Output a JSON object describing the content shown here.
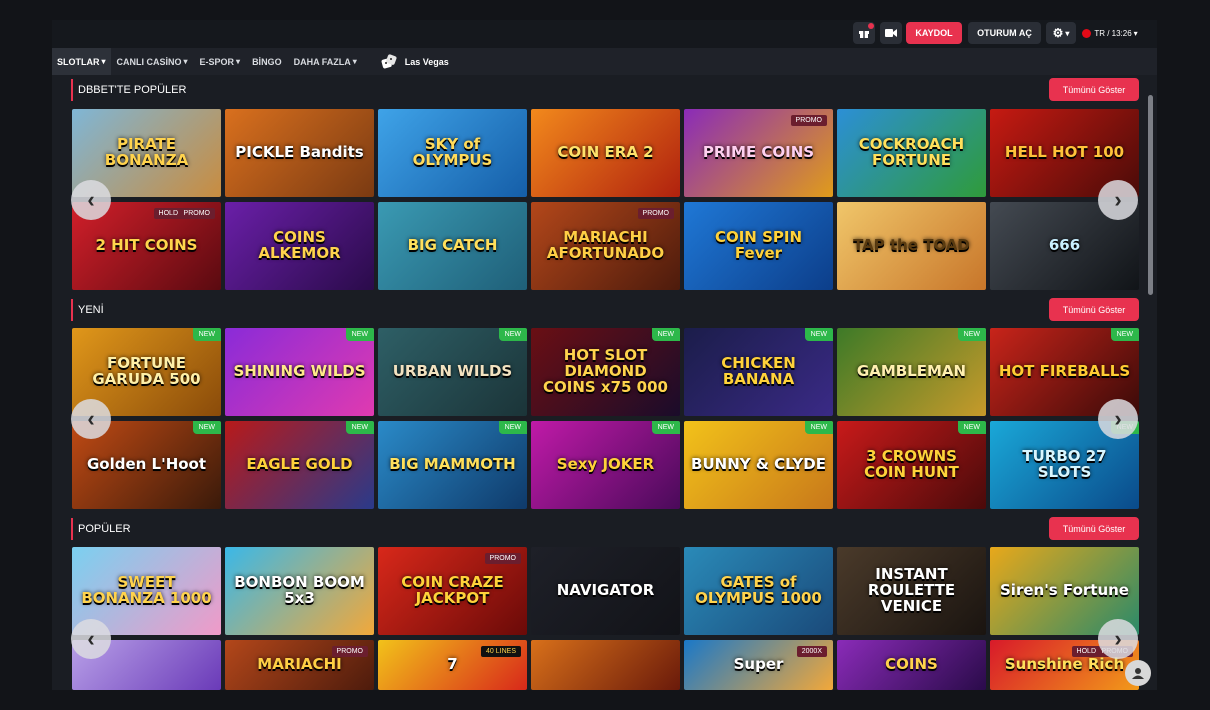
{
  "topbar": {
    "register_label": "KAYDOL",
    "login_label": "OTURUM AÇ",
    "lang_time": "TR / 13:26"
  },
  "nav": {
    "items": [
      {
        "label": "SLOTLAR",
        "dropdown": true
      },
      {
        "label": "CANLI CASİNO",
        "dropdown": true
      },
      {
        "label": "E-SPOR",
        "dropdown": true
      },
      {
        "label": "BİNGO",
        "dropdown": false
      },
      {
        "label": "DAHA FAZLA",
        "dropdown": true
      }
    ],
    "las_vegas": "Las Vegas"
  },
  "sections": [
    {
      "title": "DBBET'TE POPÜLER",
      "show_all": "Tümünü Göster",
      "games": [
        {
          "name": "PIRATE BONANZA",
          "bg": [
            "#7fb6d6",
            "#c98c3f"
          ],
          "color": "#ffd34d"
        },
        {
          "name": "PICKLE Bandits",
          "bg": [
            "#d9701e",
            "#7a3a12"
          ],
          "color": "#ffffff"
        },
        {
          "name": "SKY of OLYMPUS",
          "bg": [
            "#3fa3e8",
            "#155ea8"
          ],
          "color": "#ffdc5c"
        },
        {
          "name": "COIN ERA 2",
          "bg": [
            "#f2891c",
            "#b0210e"
          ],
          "color": "#ffe26b"
        },
        {
          "name": "PRIME COINS",
          "bg": [
            "#8a2bb8",
            "#e09c1a"
          ],
          "color": "#ffd0f0",
          "badge": "PROMO"
        },
        {
          "name": "COCKROACH FORTUNE",
          "bg": [
            "#2c8fd6",
            "#2f9b3a"
          ],
          "color": "#ffe05c"
        },
        {
          "name": "HELL HOT 100",
          "bg": [
            "#c61a12",
            "#4a0b08"
          ],
          "color": "#ffc23a"
        },
        {
          "name": "2 HIT COINS",
          "bg": [
            "#d21f2a",
            "#5a0a10"
          ],
          "color": "#ffd54d",
          "badge": "PROMO",
          "badge2": "HOLD"
        },
        {
          "name": "COINS ALKEMOR",
          "bg": [
            "#6a1fa8",
            "#2a0b4a"
          ],
          "color": "#ffd34d"
        },
        {
          "name": "BIG CATCH",
          "bg": [
            "#3a9ab3",
            "#1f5f78"
          ],
          "color": "#ffe05c"
        },
        {
          "name": "MARIACHI AFORTUNADO",
          "bg": [
            "#b3471a",
            "#4d1b0c"
          ],
          "color": "#ffcf45",
          "badge": "PROMO"
        },
        {
          "name": "COIN SPIN Fever",
          "bg": [
            "#1f78d6",
            "#0c3e8a"
          ],
          "color": "#ffd23a"
        },
        {
          "name": "TAP the TOAD",
          "bg": [
            "#f0c66a",
            "#c8762a"
          ],
          "color": "#5a3b10"
        },
        {
          "name": "666",
          "bg": [
            "#444a52",
            "#111418"
          ],
          "color": "#c9f0ff"
        }
      ]
    },
    {
      "title": "YENİ",
      "show_all": "Tümünü Göster",
      "games": [
        {
          "name": "FORTUNE GARUDA 500",
          "bg": [
            "#e0971a",
            "#8a4b0a"
          ],
          "color": "#fff0a8",
          "badge": "NEW"
        },
        {
          "name": "SHINING WILDS",
          "bg": [
            "#8a2bd8",
            "#e03ab0"
          ],
          "color": "#ffe98a",
          "badge": "NEW"
        },
        {
          "name": "URBAN WILDS",
          "bg": [
            "#2e5f66",
            "#1b3438"
          ],
          "color": "#f2e2c0",
          "badge": "NEW"
        },
        {
          "name": "HOT SLOT DIAMOND COINS x75 000",
          "bg": [
            "#6a0f14",
            "#1a0c2a"
          ],
          "color": "#ffd34d",
          "badge": "NEW"
        },
        {
          "name": "CHICKEN BANANA",
          "bg": [
            "#1b1d4a",
            "#3a2a86"
          ],
          "color": "#ffd23a",
          "badge": "NEW"
        },
        {
          "name": "GAMBLEMAN",
          "bg": [
            "#3d7a28",
            "#c79a2a"
          ],
          "color": "#fff0b0",
          "badge": "NEW"
        },
        {
          "name": "HOT FIREBALLS",
          "bg": [
            "#c8241a",
            "#3a0a08"
          ],
          "color": "#ffcc33",
          "badge": "NEW"
        },
        {
          "name": "Golden L'Hoot",
          "bg": [
            "#c04a14",
            "#3a1a0a"
          ],
          "color": "#ffffff",
          "badge": "NEW"
        },
        {
          "name": "EAGLE GOLD",
          "bg": [
            "#b81a1a",
            "#2a3a8a"
          ],
          "color": "#ffd23a",
          "badge": "NEW"
        },
        {
          "name": "BIG MAMMOTH",
          "bg": [
            "#2a8ac8",
            "#0f3a6a"
          ],
          "color": "#ffe05c",
          "badge": "NEW"
        },
        {
          "name": "Sexy JOKER",
          "bg": [
            "#c01aa8",
            "#4a0a5a"
          ],
          "color": "#ffd23a",
          "badge": "NEW"
        },
        {
          "name": "BUNNY & CLYDE",
          "bg": [
            "#f2c21a",
            "#c8781a"
          ],
          "color": "#ffffff",
          "badge": "NEW"
        },
        {
          "name": "3 CROWNS COIN HUNT",
          "bg": [
            "#c81a1a",
            "#4a0a0a"
          ],
          "color": "#ffd23a",
          "badge": "NEW"
        },
        {
          "name": "TURBO 27 SLOTS",
          "bg": [
            "#1aa8d8",
            "#0a4a8a"
          ],
          "color": "#d8f6ff",
          "badge": "NEW"
        }
      ]
    },
    {
      "title": "POPÜLER",
      "show_all": "Tümünü Göster",
      "games": [
        {
          "name": "SWEET BONANZA 1000",
          "bg": [
            "#7ad0f0",
            "#f09ac8"
          ],
          "color": "#ffd34d"
        },
        {
          "name": "BONBON BOOM 5x3",
          "bg": [
            "#3ab8e8",
            "#f2a83a"
          ],
          "color": "#ffffff"
        },
        {
          "name": "COIN CRAZE JACKPOT",
          "bg": [
            "#d8281a",
            "#6a0a08"
          ],
          "color": "#ffd23a",
          "badge": "PROMO"
        },
        {
          "name": "NAVIGATOR",
          "bg": [
            "#1e2028",
            "#121318"
          ],
          "color": "#ffffff"
        },
        {
          "name": "GATES of OLYMPUS 1000",
          "bg": [
            "#2a8ab8",
            "#1a4a7a"
          ],
          "color": "#ffd34d"
        },
        {
          "name": "INSTANT ROULETTE VENICE",
          "bg": [
            "#4a3a2a",
            "#1a1410"
          ],
          "color": "#ffffff"
        },
        {
          "name": "Siren's Fortune",
          "bg": [
            "#e8a81a",
            "#2a8a6a"
          ],
          "color": "#ffffff"
        },
        {
          "name": "",
          "bg": [
            "#b8a0e8",
            "#6a3ab8"
          ],
          "color": "#ffffff"
        },
        {
          "name": "MARIACHI",
          "bg": [
            "#b3471a",
            "#4d1b0c"
          ],
          "color": "#ffcf45",
          "badge": "PROMO"
        },
        {
          "name": "7",
          "bg": [
            "#f2c21a",
            "#d8281a"
          ],
          "color": "#ffffff",
          "badge": "40 LINES"
        },
        {
          "name": "",
          "bg": [
            "#d8701a",
            "#6a1a0a"
          ],
          "color": "#ffd23a"
        },
        {
          "name": "Super",
          "bg": [
            "#1a78c8",
            "#f2a83a"
          ],
          "color": "#ffffff",
          "badge": "2000X"
        },
        {
          "name": "COINS",
          "bg": [
            "#8a2bb8",
            "#2a0b4a"
          ],
          "color": "#ffd34d"
        },
        {
          "name": "Sunshine Rich",
          "bg": [
            "#d81a2a",
            "#f29a1a"
          ],
          "color": "#ffe05c",
          "badge": "PROMO",
          "badge2": "HOLD"
        }
      ]
    }
  ],
  "colors": {
    "accent": "#e8324f",
    "bg": "#1a1d23",
    "new_badge": "#2db84a"
  }
}
